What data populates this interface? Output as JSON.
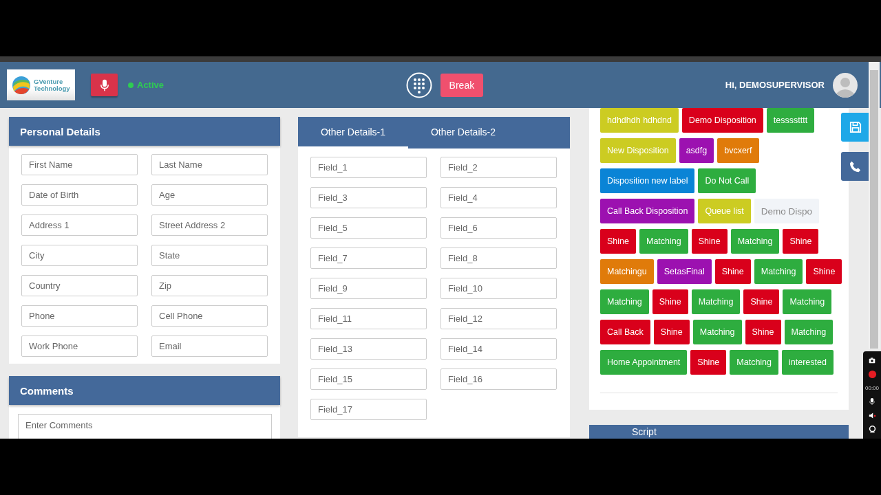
{
  "header": {
    "logo": {
      "line1": "GVenture",
      "line2": "Technology"
    },
    "status": {
      "label": "Active"
    },
    "break_button": "Break",
    "greeting": "Hi, DEMOSUPERVISOR"
  },
  "personal_details": {
    "title": "Personal Details",
    "fields": [
      {
        "placeholder": "First Name"
      },
      {
        "placeholder": "Last Name"
      },
      {
        "placeholder": "Date of Birth"
      },
      {
        "placeholder": "Age"
      },
      {
        "placeholder": "Address 1"
      },
      {
        "placeholder": "Street Address 2"
      },
      {
        "placeholder": "City"
      },
      {
        "placeholder": "State"
      },
      {
        "placeholder": "Country"
      },
      {
        "placeholder": "Zip"
      },
      {
        "placeholder": "Phone"
      },
      {
        "placeholder": "Cell Phone"
      },
      {
        "placeholder": "Work Phone"
      },
      {
        "placeholder": "Email"
      }
    ]
  },
  "comments": {
    "title": "Comments",
    "placeholder": "Enter Comments"
  },
  "other_details": {
    "tabs": [
      {
        "label": "Other Details-1",
        "selected": true
      },
      {
        "label": "Other Details-2",
        "selected": false
      }
    ],
    "fields": [
      {
        "placeholder": "Field_1"
      },
      {
        "placeholder": "Field_2"
      },
      {
        "placeholder": "Field_3"
      },
      {
        "placeholder": "Field_4"
      },
      {
        "placeholder": "Field_5"
      },
      {
        "placeholder": "Field_6"
      },
      {
        "placeholder": "Field_7"
      },
      {
        "placeholder": "Field_8"
      },
      {
        "placeholder": "Field_9"
      },
      {
        "placeholder": "Field_10"
      },
      {
        "placeholder": "Field_11"
      },
      {
        "placeholder": "Field_12"
      },
      {
        "placeholder": "Field_13"
      },
      {
        "placeholder": "Field_14"
      },
      {
        "placeholder": "Field_15"
      },
      {
        "placeholder": "Field_16"
      },
      {
        "placeholder": "Field_17"
      }
    ]
  },
  "dispositions": {
    "rows": [
      {
        "buttons": [
          {
            "label": "hdhdhdh hdhdnd",
            "color": "#cccc22"
          },
          {
            "label": "Demo Disposition",
            "color": "#d9001b"
          },
          {
            "label": "tesssstttt",
            "color": "#2ead3f"
          }
        ]
      },
      {
        "buttons": [
          {
            "label": "New Disposition",
            "color": "#cccc22"
          },
          {
            "label": "asdfg",
            "color": "#9c11b0"
          },
          {
            "label": "bvcxerf",
            "color": "#e07b0a"
          }
        ]
      },
      {
        "buttons": [
          {
            "label": "Disposition new label",
            "color": "#0a84d6"
          },
          {
            "label": "Do Not Call",
            "color": "#2ead3f"
          }
        ]
      },
      {
        "buttons": [
          {
            "label": "Call Back Disposition",
            "color": "#9c11b0"
          },
          {
            "label": "Queue list",
            "color": "#cccc22"
          },
          {
            "label": "Demo Dispo",
            "color": "#f1f4f8"
          }
        ]
      },
      {
        "buttons": [
          {
            "label": "Shine",
            "color": "#d9001b"
          },
          {
            "label": "Matching",
            "color": "#2ead3f"
          },
          {
            "label": "Shine",
            "color": "#d9001b"
          },
          {
            "label": "Matching",
            "color": "#2ead3f"
          },
          {
            "label": "Shine",
            "color": "#d9001b"
          }
        ]
      },
      {
        "buttons": [
          {
            "label": "Matchingu",
            "color": "#e07b0a"
          },
          {
            "label": "SetasFinal",
            "color": "#9c11b0"
          },
          {
            "label": "Shine",
            "color": "#d9001b"
          },
          {
            "label": "Matching",
            "color": "#2ead3f"
          },
          {
            "label": "Shine",
            "color": "#d9001b"
          }
        ]
      },
      {
        "buttons": [
          {
            "label": "Matching",
            "color": "#2ead3f"
          },
          {
            "label": "Shine",
            "color": "#d9001b"
          },
          {
            "label": "Matching",
            "color": "#2ead3f"
          },
          {
            "label": "Shine",
            "color": "#d9001b"
          },
          {
            "label": "Matching",
            "color": "#2ead3f"
          }
        ]
      },
      {
        "buttons": [
          {
            "label": "Call Back",
            "color": "#d9001b"
          },
          {
            "label": "Shine",
            "color": "#d9001b"
          },
          {
            "label": "Matching",
            "color": "#2ead3f"
          },
          {
            "label": "Shine",
            "color": "#d9001b"
          },
          {
            "label": "Matching",
            "color": "#2ead3f"
          }
        ]
      },
      {
        "buttons": [
          {
            "label": "Home Appointment",
            "color": "#2ead3f"
          },
          {
            "label": "Shine",
            "color": "#d9001b"
          },
          {
            "label": "Matching",
            "color": "#2ead3f"
          },
          {
            "label": "interested",
            "color": "#2ead3f"
          }
        ]
      }
    ]
  },
  "script_panel": {
    "title": "Script"
  },
  "recorder": {
    "timer": "00:00"
  }
}
